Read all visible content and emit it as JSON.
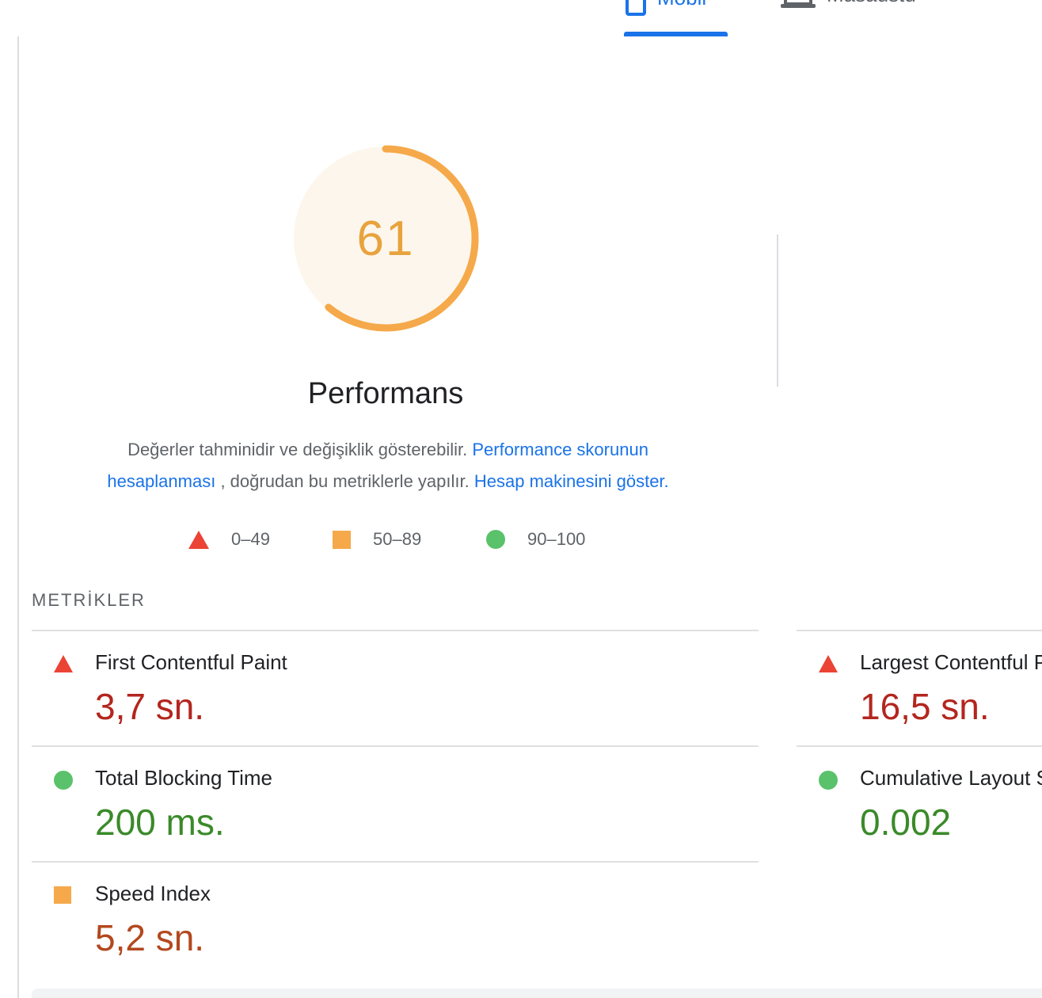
{
  "tabs": {
    "mobile_label": "Mobil",
    "desktop_label": "Masaüstü"
  },
  "score": {
    "value": "61",
    "fraction": 0.61,
    "color": "#f5a94a",
    "background": "#fdf6ec"
  },
  "performance": {
    "title": "Performans",
    "desc_text_1": "Değerler tahminidir ve değişiklik gösterebilir.",
    "desc_link_1": "Performance skorunun hesaplanması",
    "desc_text_2": ", doğrudan bu metriklerle yapılır.",
    "desc_link_2": "Hesap makinesini göster."
  },
  "legend": [
    {
      "icon": "triangle-red",
      "label": "0–49"
    },
    {
      "icon": "square-orange",
      "label": "50–89"
    },
    {
      "icon": "circle-green",
      "label": "90–100"
    }
  ],
  "metrics_section": {
    "label": "METRİKLER",
    "items": [
      {
        "name": "First Contentful Paint",
        "value": "3,7 sn.",
        "status": "red"
      },
      {
        "name": "Largest Contentful Paint",
        "value": "16,5 sn.",
        "status": "red"
      },
      {
        "name": "Total Blocking Time",
        "value": "200 ms.",
        "status": "green"
      },
      {
        "name": "Cumulative Layout Shift",
        "value": "0.002",
        "status": "green"
      },
      {
        "name": "Speed Index",
        "value": "5,2 sn.",
        "status": "orange"
      }
    ]
  },
  "colors": {
    "accent": "#1a73e8",
    "fail": "#eb4335",
    "average": "#f5a94a",
    "pass": "#5ac26a"
  }
}
